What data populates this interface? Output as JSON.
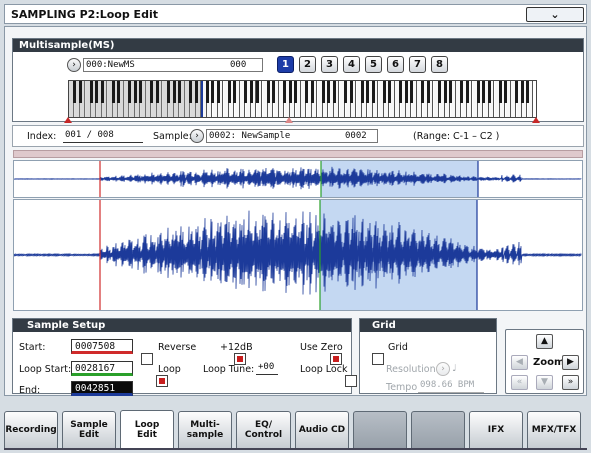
{
  "window": {
    "title": "SAMPLING P2:Loop Edit"
  },
  "multisample": {
    "header": "Multisample(MS)",
    "name_field": "000:NewMS",
    "name_suffix": "000",
    "buttons": [
      "1",
      "2",
      "3",
      "4",
      "5",
      "6",
      "7",
      "8"
    ],
    "selected_button": "1"
  },
  "index": {
    "label": "Index:",
    "value": "001 / 008",
    "sample_label": "Sample:",
    "sample_value": "0002: NewSample",
    "sample_suffix": "0002",
    "range": "(Range: C-1  – C2  )"
  },
  "setup": {
    "header": "Sample Setup",
    "start_label": "Start:",
    "start_value": "0007508",
    "loop_start_label": "Loop Start:",
    "loop_start_value": "0028167",
    "end_label": "End:",
    "end_value": "0042851",
    "reverse_label": "Reverse",
    "loop_label": "Loop",
    "plus12_label": "+12dB",
    "loop_tune_label": "Loop Tune:",
    "loop_tune_value": "+00",
    "use_zero_label": "Use Zero",
    "loop_lock_label": "Loop Lock",
    "reverse_checked": false,
    "loop_checked": true,
    "plus12_checked": true,
    "use_zero_checked": true,
    "loop_lock_checked": false
  },
  "grid": {
    "header": "Grid",
    "grid_label": "Grid",
    "grid_checked": false,
    "resolution_label": "Resolution",
    "tempo_label": "Tempo:",
    "tempo_value": "098.66 BPM"
  },
  "zoom": {
    "label": "Zoom"
  },
  "tabs": [
    {
      "label": "Recording"
    },
    {
      "label": "Sample\nEdit"
    },
    {
      "label": "Loop\nEdit"
    },
    {
      "label": "Multi-\nsample"
    },
    {
      "label": "EQ/\nControl"
    },
    {
      "label": "Audio CD"
    },
    {
      "label": ""
    },
    {
      "label": ""
    },
    {
      "label": "IFX"
    },
    {
      "label": "MFX/TFX"
    }
  ],
  "active_tab": "Loop\nEdit",
  "colors": {
    "waveform": "#1c3a9a",
    "start_marker": "#d02a2a",
    "loop_start_marker": "#2aa02a",
    "end_marker": "#1c3a9a",
    "loop_region": "#c4d8f2"
  }
}
